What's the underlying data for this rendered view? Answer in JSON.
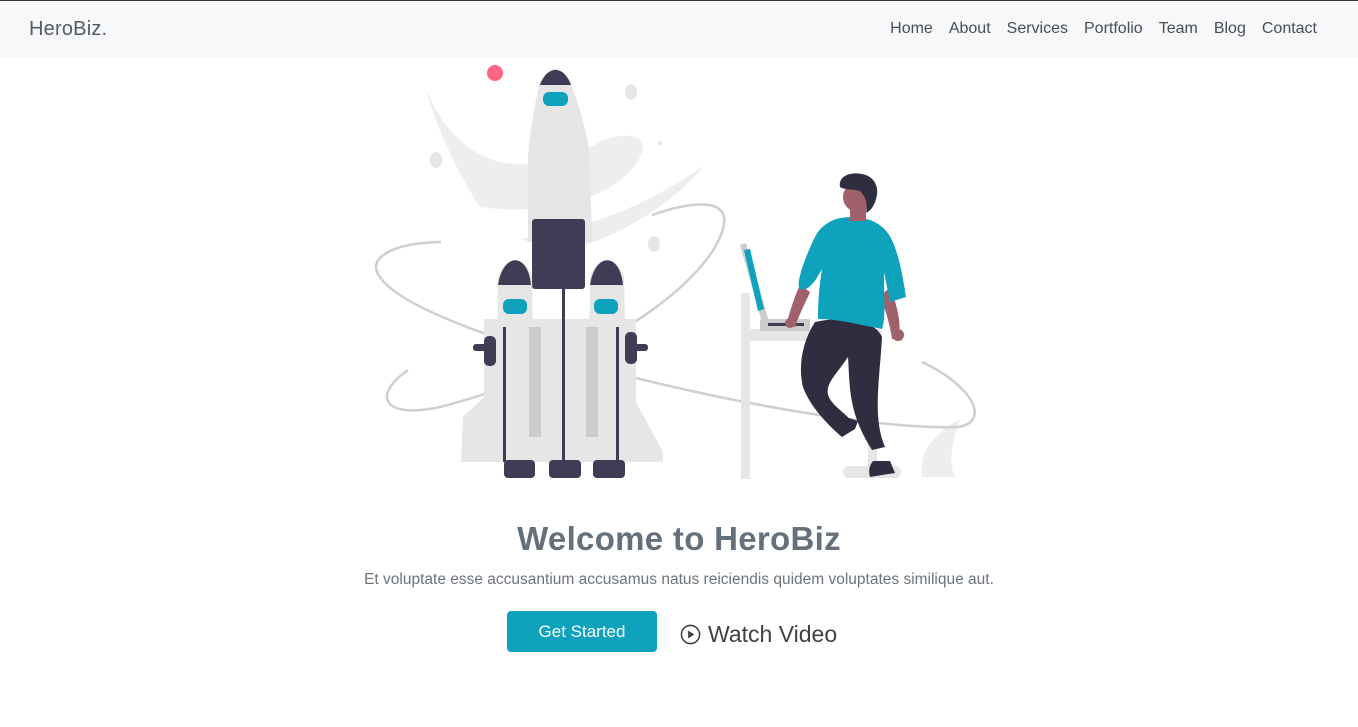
{
  "header": {
    "logo": "HeroBiz.",
    "nav": [
      {
        "label": "Home"
      },
      {
        "label": "About"
      },
      {
        "label": "Services"
      },
      {
        "label": "Portfolio"
      },
      {
        "label": "Team"
      },
      {
        "label": "Blog"
      },
      {
        "label": "Contact"
      }
    ]
  },
  "hero": {
    "title": "Welcome to HeroBiz",
    "subtitle": "Et voluptate esse accusantium accusamus natus reiciendis quidem voluptates similique aut.",
    "primary_button": "Get Started",
    "video_button": "Watch Video",
    "video_icon": "play-circle-icon",
    "illustration": "rocket-launch-illustration"
  },
  "colors": {
    "accent": "#0ea2bd",
    "dark": "#3f3d56",
    "light_gray": "#e6e6e6",
    "pink": "#ff6584",
    "skin": "#a0616a"
  }
}
